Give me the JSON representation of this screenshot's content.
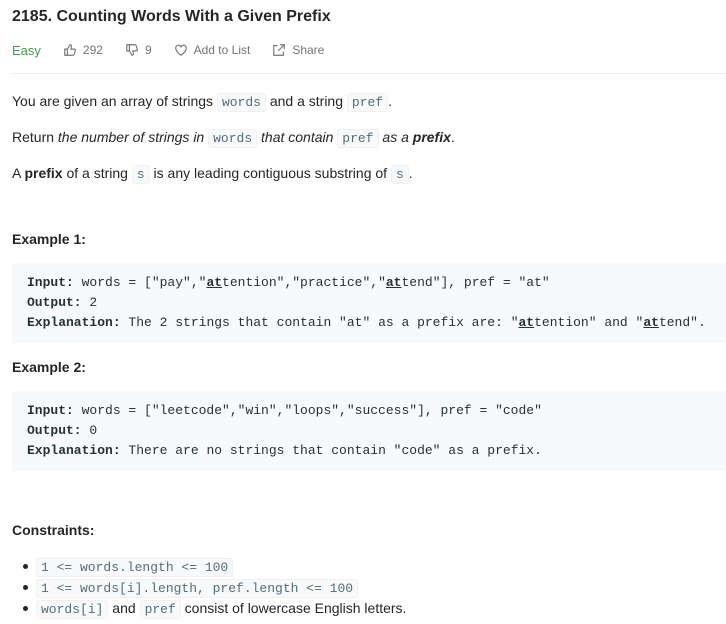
{
  "problem": {
    "title": "2185. Counting Words With a Given Prefix",
    "difficulty": "Easy",
    "likes": "292",
    "dislikes": "9",
    "add_to_list": "Add to List",
    "share": "Share"
  },
  "description": {
    "p1": [
      "You are given an array of strings ",
      "words",
      " and a string ",
      "pref",
      "."
    ],
    "p2": [
      "Return ",
      "the number of strings in ",
      "words",
      " that contain ",
      "pref",
      " as a ",
      "prefix",
      "."
    ],
    "p3": [
      "A ",
      "prefix",
      " of a string ",
      "s",
      " is any leading contiguous substring of ",
      "s",
      "."
    ]
  },
  "examples": [
    {
      "title": "Example 1:",
      "input_label": "Input:",
      "input_parts": [
        " words = [\"pay\",\"",
        "at",
        "tention\",\"practice\",\"",
        "at",
        "tend\"], pref = \"at\""
      ],
      "output_label": "Output:",
      "output": " 2",
      "explanation_label": "Explanation:",
      "explanation_parts": [
        " The 2 strings that contain \"at\" as a prefix are: \"",
        "at",
        "tention\" and \"",
        "at",
        "tend\"."
      ]
    },
    {
      "title": "Example 2:",
      "input_label": "Input:",
      "input": " words = [\"leetcode\",\"win\",\"loops\",\"success\"], pref = \"code\"",
      "output_label": "Output:",
      "output": " 0",
      "explanation_label": "Explanation:",
      "explanation": " There are no strings that contain \"code\" as a prefix."
    }
  ],
  "constraints": {
    "title": "Constraints:",
    "c1": "1 <= words.length <= 100",
    "c2": "1 <= words[i].length, pref.length <= 100",
    "c3": [
      "words[i]",
      " and ",
      "pref",
      " consist of lowercase English letters."
    ]
  },
  "icons": {
    "like": "thumbs-up-icon",
    "dislike": "thumbs-down-icon",
    "add": "heart-icon",
    "share": "share-icon"
  },
  "colors": {
    "difficulty": "#43a047",
    "code_bg": "#f7f9fa",
    "meta": "#757575"
  }
}
